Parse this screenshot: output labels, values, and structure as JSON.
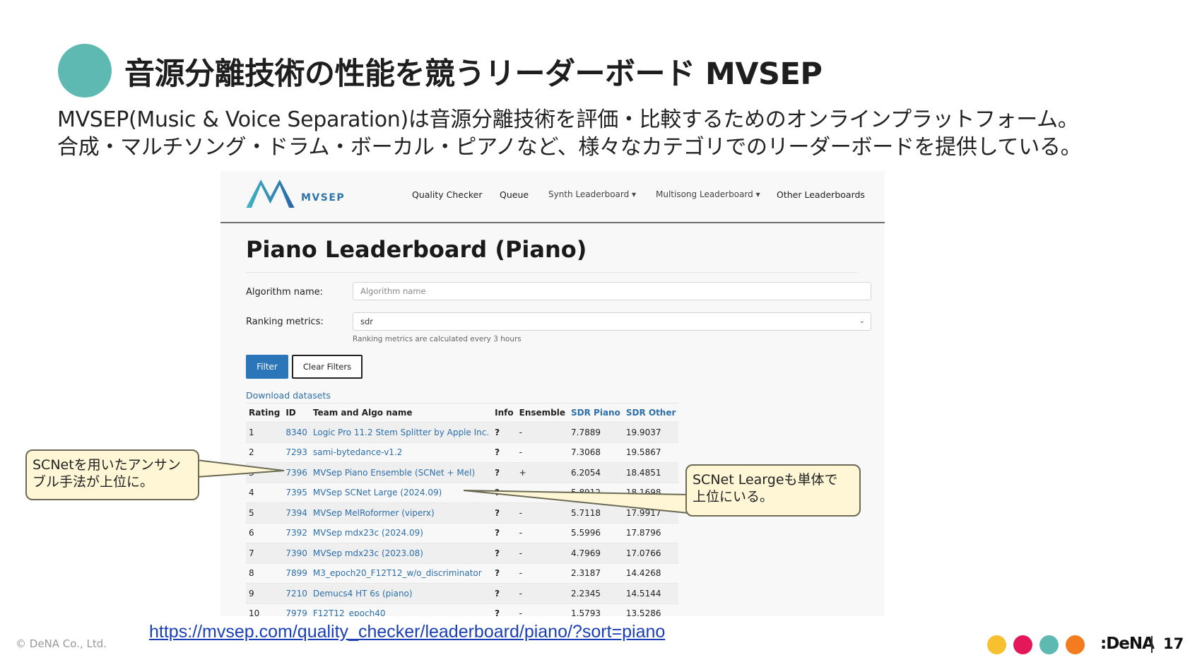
{
  "slide": {
    "title": "音源分離技術の性能を競うリーダーボード MVSEP",
    "desc_line1": "MVSEP(Music & Voice Separation)は音源分離技術を評価・比較するためのオンラインプラットフォーム。",
    "desc_line2": "合成・マルチソング・ドラム・ボーカル・ピアノなど、様々なカテゴリでのリーダーボードを提供している。"
  },
  "navbar": {
    "logo_text": "MVSEP",
    "items": [
      "Quality Checker",
      "Queue",
      "Synth Leaderboard ▾",
      "Multisong Leaderboard ▾",
      "Other Leaderboards"
    ]
  },
  "leaderboard": {
    "title": "Piano Leaderboard (Piano)",
    "algo_label": "Algorithm name:",
    "algo_placeholder": "Algorithm name",
    "metrics_label": "Ranking metrics:",
    "metrics_value": "sdr",
    "metrics_help": "Ranking metrics are calculated every 3 hours",
    "filter_label": "Filter",
    "clear_label": "Clear Filters",
    "download_label": "Download datasets",
    "columns": [
      "Rating",
      "ID",
      "Team and Algo name",
      "Info",
      "Ensemble",
      "SDR Piano",
      "SDR Other"
    ],
    "rows": [
      {
        "rating": "1",
        "id": "8340",
        "name": "Logic Pro 11.2 Stem Splitter by Apple Inc.",
        "info": "?",
        "ensemble": "-",
        "sdr_piano": "7.7889",
        "sdr_other": "19.9037"
      },
      {
        "rating": "2",
        "id": "7293",
        "name": "sami-bytedance-v1.2",
        "info": "?",
        "ensemble": "-",
        "sdr_piano": "7.3068",
        "sdr_other": "19.5867"
      },
      {
        "rating": "3",
        "id": "7396",
        "name": "MVSep Piano Ensemble (SCNet + Mel)",
        "info": "?",
        "ensemble": "+",
        "sdr_piano": "6.2054",
        "sdr_other": "18.4851"
      },
      {
        "rating": "4",
        "id": "7395",
        "name": "MVSep SCNet Large (2024.09)",
        "info": "?",
        "ensemble": "-",
        "sdr_piano": "5.8912",
        "sdr_other": "18.1698"
      },
      {
        "rating": "5",
        "id": "7394",
        "name": "MVSep MelRoformer (viperx)",
        "info": "?",
        "ensemble": "-",
        "sdr_piano": "5.7118",
        "sdr_other": "17.9917"
      },
      {
        "rating": "6",
        "id": "7392",
        "name": "MVSep mdx23c (2024.09)",
        "info": "?",
        "ensemble": "-",
        "sdr_piano": "5.5996",
        "sdr_other": "17.8796"
      },
      {
        "rating": "7",
        "id": "7390",
        "name": "MVSep mdx23c (2023.08)",
        "info": "?",
        "ensemble": "-",
        "sdr_piano": "4.7969",
        "sdr_other": "17.0766"
      },
      {
        "rating": "8",
        "id": "7899",
        "name": "M3_epoch20_F12T12_w/o_discriminator",
        "info": "?",
        "ensemble": "-",
        "sdr_piano": "2.3187",
        "sdr_other": "14.4268"
      },
      {
        "rating": "9",
        "id": "7210",
        "name": "Demucs4 HT 6s (piano)",
        "info": "?",
        "ensemble": "-",
        "sdr_piano": "2.2345",
        "sdr_other": "14.5144"
      },
      {
        "rating": "10",
        "id": "7979",
        "name": "F12T12_epoch40",
        "info": "?",
        "ensemble": "-",
        "sdr_piano": "1.5793",
        "sdr_other": "13.5286"
      }
    ]
  },
  "callouts": {
    "left_line1": "SCNetを用いたアンサン",
    "left_line2": "ブル手法が上位に。",
    "right_line1": "SCNet Leargeも単体で",
    "right_line2": "上位にいる。"
  },
  "footer": {
    "url": "https://mvsep.com/quality_checker/leaderboard/piano/?sort=piano",
    "copyright": "© DeNA Co., Ltd.",
    "brand": ":DeNA",
    "page_number": "17",
    "dot_colors": [
      "#f6c02f",
      "#e3175a",
      "#5fb9b3",
      "#f47c20"
    ]
  }
}
